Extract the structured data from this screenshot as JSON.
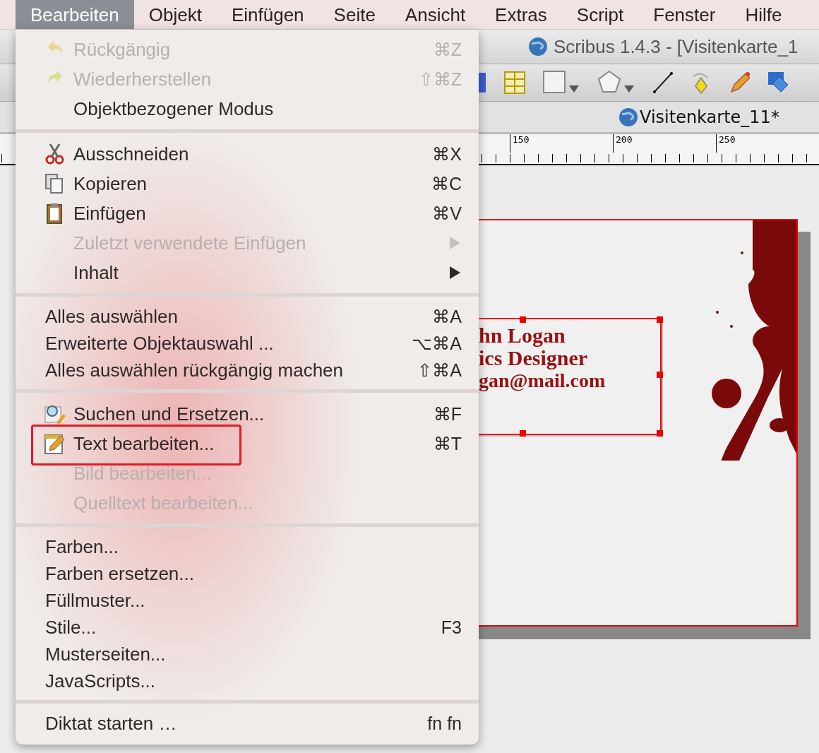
{
  "menubar": [
    {
      "label": "Bearbeiten",
      "selected": true
    },
    {
      "label": "Objekt",
      "selected": false
    },
    {
      "label": "Einfügen",
      "selected": false
    },
    {
      "label": "Seite",
      "selected": false
    },
    {
      "label": "Ansicht",
      "selected": false
    },
    {
      "label": "Extras",
      "selected": false
    },
    {
      "label": "Script",
      "selected": false
    },
    {
      "label": "Fenster",
      "selected": false
    },
    {
      "label": "Hilfe",
      "selected": false
    }
  ],
  "window": {
    "title": "Scribus 1.4.3 - [Visitenkarte_1"
  },
  "tab": {
    "label": "Visitenkarte_11*"
  },
  "ruler": [
    "150",
    "200",
    "250"
  ],
  "card": {
    "lines": [
      "hn Logan",
      "ics Designer",
      "gan@mail.com"
    ]
  },
  "menu": {
    "groups": [
      [
        {
          "label": "Rückgängig",
          "shortcut": "⌘Z",
          "disabled": true
        },
        {
          "label": "Wiederherstellen",
          "shortcut": "⇧⌘Z",
          "disabled": true
        },
        {
          "label": "Objektbezogener Modus",
          "disabled": false
        }
      ],
      [
        {
          "label": "Ausschneiden",
          "shortcut": "⌘X",
          "disabled": false
        },
        {
          "label": "Kopieren",
          "shortcut": "⌘C",
          "disabled": false
        },
        {
          "label": "Einfügen",
          "shortcut": "⌘V",
          "disabled": false
        },
        {
          "label": "Zuletzt verwendete Einfügen",
          "disabled": true,
          "submenu": true
        },
        {
          "label": "Inhalt",
          "disabled": false,
          "submenu": true
        }
      ],
      [
        {
          "label": "Alles auswählen",
          "shortcut": "⌘A",
          "disabled": false
        },
        {
          "label": "Erweiterte Objektauswahl ...",
          "shortcut": "⌥⌘A",
          "disabled": false
        },
        {
          "label": "Alles auswählen rückgängig machen",
          "shortcut": "⇧⌘A",
          "disabled": false
        }
      ],
      [
        {
          "label": "Suchen und Ersetzen...",
          "shortcut": "⌘F",
          "disabled": false
        },
        {
          "label": "Text bearbeiten...",
          "shortcut": "⌘T",
          "disabled": false,
          "highlighted": true
        },
        {
          "label": "Bild bearbeiten...",
          "disabled": true
        },
        {
          "label": "Quelltext bearbeiten...",
          "disabled": true
        }
      ],
      [
        {
          "label": "Farben...",
          "disabled": false
        },
        {
          "label": "Farben ersetzen...",
          "disabled": false
        },
        {
          "label": "Füllmuster...",
          "disabled": false
        },
        {
          "label": "Stile...",
          "shortcut": "F3",
          "disabled": false
        },
        {
          "label": "Musterseiten...",
          "disabled": false
        },
        {
          "label": "JavaScripts...",
          "disabled": false
        }
      ],
      [
        {
          "label": "Diktat starten …",
          "shortcut": "fn fn",
          "disabled": false
        }
      ]
    ]
  }
}
